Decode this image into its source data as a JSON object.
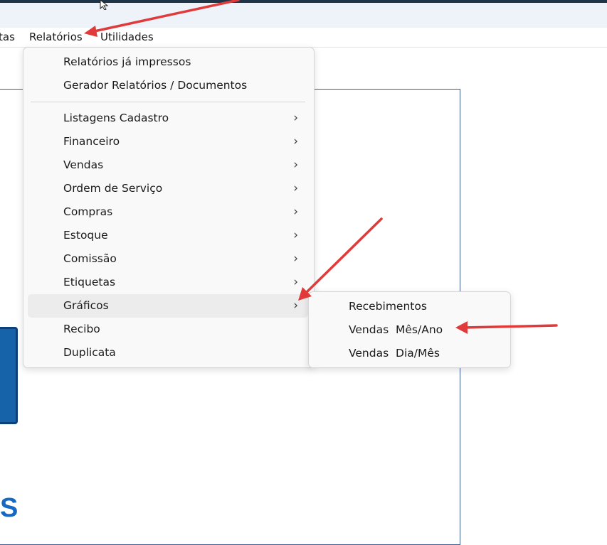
{
  "menubar": {
    "items": [
      "tas",
      "Relatórios",
      "Utilidades"
    ]
  },
  "main_menu": {
    "items": [
      {
        "label": "Relatórios já impressos",
        "submenu": false
      },
      {
        "label": "Gerador Relatórios / Documentos",
        "submenu": false
      },
      {
        "label": "Listagens Cadastro",
        "submenu": true
      },
      {
        "label": "Financeiro",
        "submenu": true
      },
      {
        "label": "Vendas",
        "submenu": true
      },
      {
        "label": "Ordem de Serviço",
        "submenu": true
      },
      {
        "label": "Compras",
        "submenu": true
      },
      {
        "label": "Estoque",
        "submenu": true
      },
      {
        "label": "Comissão",
        "submenu": true
      },
      {
        "label": "Etiquetas",
        "submenu": true
      },
      {
        "label": "Gráficos",
        "submenu": true,
        "highlighted": true
      },
      {
        "label": "Recibo",
        "submenu": false
      },
      {
        "label": "Duplicata",
        "submenu": false
      }
    ],
    "chevron": "›"
  },
  "sub_menu": {
    "items": [
      "Recebimentos",
      "Vendas  Mês/Ano",
      "Vendas  Dia/Mês"
    ]
  },
  "background": {
    "logo_text": "S"
  },
  "colors": {
    "titlebar": "#1f3447",
    "toolbar": "#eef2f9",
    "menu_bg": "#f9f9f9",
    "menu_hover": "#ececec",
    "panel_border": "#3d5a94",
    "logo_blue": "#1569c2",
    "annotation_red": "#e03a3a"
  },
  "icons": {
    "cursor": "mouse-pointer-icon",
    "chevron": "chevron-right-icon",
    "annotation": "red-arrow-annotation"
  }
}
